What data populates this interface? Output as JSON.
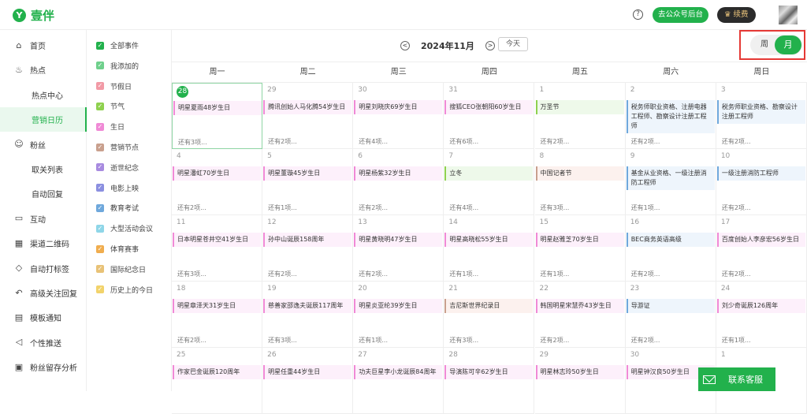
{
  "app": {
    "name": "壹伴",
    "logo_char": "Y"
  },
  "topbar": {
    "help_icon": "?",
    "go_backend_label": "去公众号后台",
    "renew_label": "续费"
  },
  "nav": [
    {
      "label": "首页",
      "icon": "home-icon",
      "glyph": "⌂",
      "sub": false
    },
    {
      "label": "热点",
      "icon": "flame-icon",
      "glyph": "♨",
      "sub": false
    },
    {
      "label": "热点中心",
      "icon": "",
      "glyph": "",
      "sub": true
    },
    {
      "label": "营销日历",
      "icon": "",
      "glyph": "",
      "sub": true,
      "active": true
    },
    {
      "label": "粉丝",
      "icon": "user-icon",
      "glyph": "☺",
      "sub": false
    },
    {
      "label": "取关列表",
      "icon": "",
      "glyph": "",
      "sub": true
    },
    {
      "label": "自动回复",
      "icon": "",
      "glyph": "",
      "sub": true
    },
    {
      "label": "互动",
      "icon": "chat-icon",
      "glyph": "▭",
      "sub": false
    },
    {
      "label": "渠道二维码",
      "icon": "qrcode-icon",
      "glyph": "▦",
      "sub": false
    },
    {
      "label": "自动打标签",
      "icon": "tag-icon",
      "glyph": "◇",
      "sub": false
    },
    {
      "label": "高级关注回复",
      "icon": "reply-icon",
      "glyph": "↶",
      "sub": false
    },
    {
      "label": "模板通知",
      "icon": "template-icon",
      "glyph": "▤",
      "sub": false
    },
    {
      "label": "个性推送",
      "icon": "send-icon",
      "glyph": "◁",
      "sub": false
    },
    {
      "label": "粉丝留存分析",
      "icon": "analytics-icon",
      "glyph": "▣",
      "sub": false
    }
  ],
  "filters": [
    {
      "label": "全部事件",
      "color": "#22b14c"
    },
    {
      "label": "我添加的",
      "color": "#6fd08c"
    },
    {
      "label": "节假日",
      "color": "#f29aa6"
    },
    {
      "label": "节气",
      "color": "#8fd14f"
    },
    {
      "label": "生日",
      "color": "#f08ad6"
    },
    {
      "label": "营销节点",
      "color": "#c9a08e"
    },
    {
      "label": "逝世纪念",
      "color": "#a88be0"
    },
    {
      "label": "电影上映",
      "color": "#8b8fe0"
    },
    {
      "label": "教育考试",
      "color": "#6fa8dc"
    },
    {
      "label": "大型活动会议",
      "color": "#8fd6e8"
    },
    {
      "label": "体育赛事",
      "color": "#f0ad4e"
    },
    {
      "label": "国际纪念日",
      "color": "#e8c277"
    },
    {
      "label": "历史上的今日",
      "color": "#f2d36b"
    }
  ],
  "calendar": {
    "title": "2024年11月",
    "prev_icon": "<",
    "next_icon": ">",
    "today_label": "今天",
    "view_week": "周",
    "view_month": "月",
    "weekdays": [
      "周一",
      "周二",
      "周三",
      "周四",
      "周五",
      "周六",
      "周日"
    ],
    "weeks": [
      [
        {
          "day": "28",
          "today": true,
          "event": "明星夏雨48岁生日",
          "type": "birthday",
          "more": "还有3项..."
        },
        {
          "day": "29",
          "event": "腾讯创始人马化腾54岁生日",
          "type": "birthday",
          "more": "还有2项..."
        },
        {
          "day": "30",
          "event": "明星刘晓庆69岁生日",
          "type": "birthday",
          "more": "还有4项..."
        },
        {
          "day": "31",
          "event": "搜狐CEO张朝阳60岁生日",
          "type": "birthday",
          "more": "还有6项..."
        },
        {
          "day": "1",
          "event": "万圣节",
          "type": "solar",
          "more": "还有2项..."
        },
        {
          "day": "2",
          "event": "税务师职业资格、注册电器工程师、勘察设计注册工程师",
          "type": "exam",
          "more": "还有2项..."
        },
        {
          "day": "3",
          "event": "税务师职业资格、勘察设计注册工程师",
          "type": "exam",
          "more": "还有2项..."
        }
      ],
      [
        {
          "day": "4",
          "event": "明星潘虹70岁生日",
          "type": "birthday",
          "more": "还有2项..."
        },
        {
          "day": "5",
          "event": "明星董璇45岁生日",
          "type": "birthday",
          "more": "还有1项..."
        },
        {
          "day": "6",
          "event": "明星杨紫32岁生日",
          "type": "birthday",
          "more": "还有2项..."
        },
        {
          "day": "7",
          "event": "立冬",
          "type": "solar",
          "more": "还有4项..."
        },
        {
          "day": "8",
          "event": "中国记者节",
          "type": "marketing",
          "more": "还有3项..."
        },
        {
          "day": "9",
          "event": "基金从业资格、一级注册消防工程师",
          "type": "exam",
          "more": "还有1项..."
        },
        {
          "day": "10",
          "event": "一级注册消防工程师",
          "type": "exam",
          "more": "还有2项..."
        }
      ],
      [
        {
          "day": "11",
          "event": "日本明星苍井空41岁生日",
          "type": "birthday",
          "more": "还有3项..."
        },
        {
          "day": "12",
          "event": "孙中山诞辰158周年",
          "type": "birthday",
          "more": "还有2项..."
        },
        {
          "day": "13",
          "event": "明星黄晓明47岁生日",
          "type": "birthday",
          "more": "还有2项..."
        },
        {
          "day": "14",
          "event": "明星高晓松55岁生日",
          "type": "birthday",
          "more": "还有1项..."
        },
        {
          "day": "15",
          "event": "明星赵雅芝70岁生日",
          "type": "birthday",
          "more": "还有1项..."
        },
        {
          "day": "16",
          "event": "BEC商务英语高级",
          "type": "exam",
          "more": "还有2项..."
        },
        {
          "day": "17",
          "event": "百度创始人李彦宏56岁生日",
          "type": "birthday",
          "more": "还有2项..."
        }
      ],
      [
        {
          "day": "18",
          "event": "明星章泽天31岁生日",
          "type": "birthday",
          "more": "还有2项..."
        },
        {
          "day": "19",
          "event": "慈善家邵逸夫诞辰117周年",
          "type": "birthday",
          "more": "还有3项..."
        },
        {
          "day": "20",
          "event": "明星炎亚纶39岁生日",
          "type": "birthday",
          "more": "还有1项..."
        },
        {
          "day": "21",
          "event": "吉尼斯世界纪录日",
          "type": "marketing",
          "more": "还有3项..."
        },
        {
          "day": "22",
          "event": "韩国明星宋慧乔43岁生日",
          "type": "birthday",
          "more": "还有2项..."
        },
        {
          "day": "23",
          "event": "导游证",
          "type": "exam",
          "more": "还有2项..."
        },
        {
          "day": "24",
          "event": "刘少奇诞辰126周年",
          "type": "birthday",
          "more": "还有1项..."
        }
      ],
      [
        {
          "day": "25",
          "event": "作家巴金诞辰120周年",
          "type": "birthday",
          "more": ""
        },
        {
          "day": "26",
          "event": "明星任重44岁生日",
          "type": "birthday",
          "more": ""
        },
        {
          "day": "27",
          "event": "功夫巨星李小龙诞辰84周年",
          "type": "birthday",
          "more": ""
        },
        {
          "day": "28",
          "event": "导演陈可辛62岁生日",
          "type": "birthday",
          "more": ""
        },
        {
          "day": "29",
          "event": "明星林志玲50岁生日",
          "type": "birthday",
          "more": ""
        },
        {
          "day": "30",
          "event": "明星钟汉良50岁生日",
          "type": "birthday",
          "more": ""
        },
        {
          "day": "1",
          "event": "",
          "type": "",
          "more": ""
        }
      ]
    ]
  },
  "event_colors": {
    "birthday": {
      "bg": "#fdf0fb",
      "border": "#f08ad6"
    },
    "solar": {
      "bg": "#eef9ea",
      "border": "#8fd14f"
    },
    "exam": {
      "bg": "#eef5fc",
      "border": "#6fa8dc"
    },
    "marketing": {
      "bg": "#fcf1ee",
      "border": "#c9a08e"
    }
  },
  "customer_service": {
    "label": "联系客服"
  }
}
